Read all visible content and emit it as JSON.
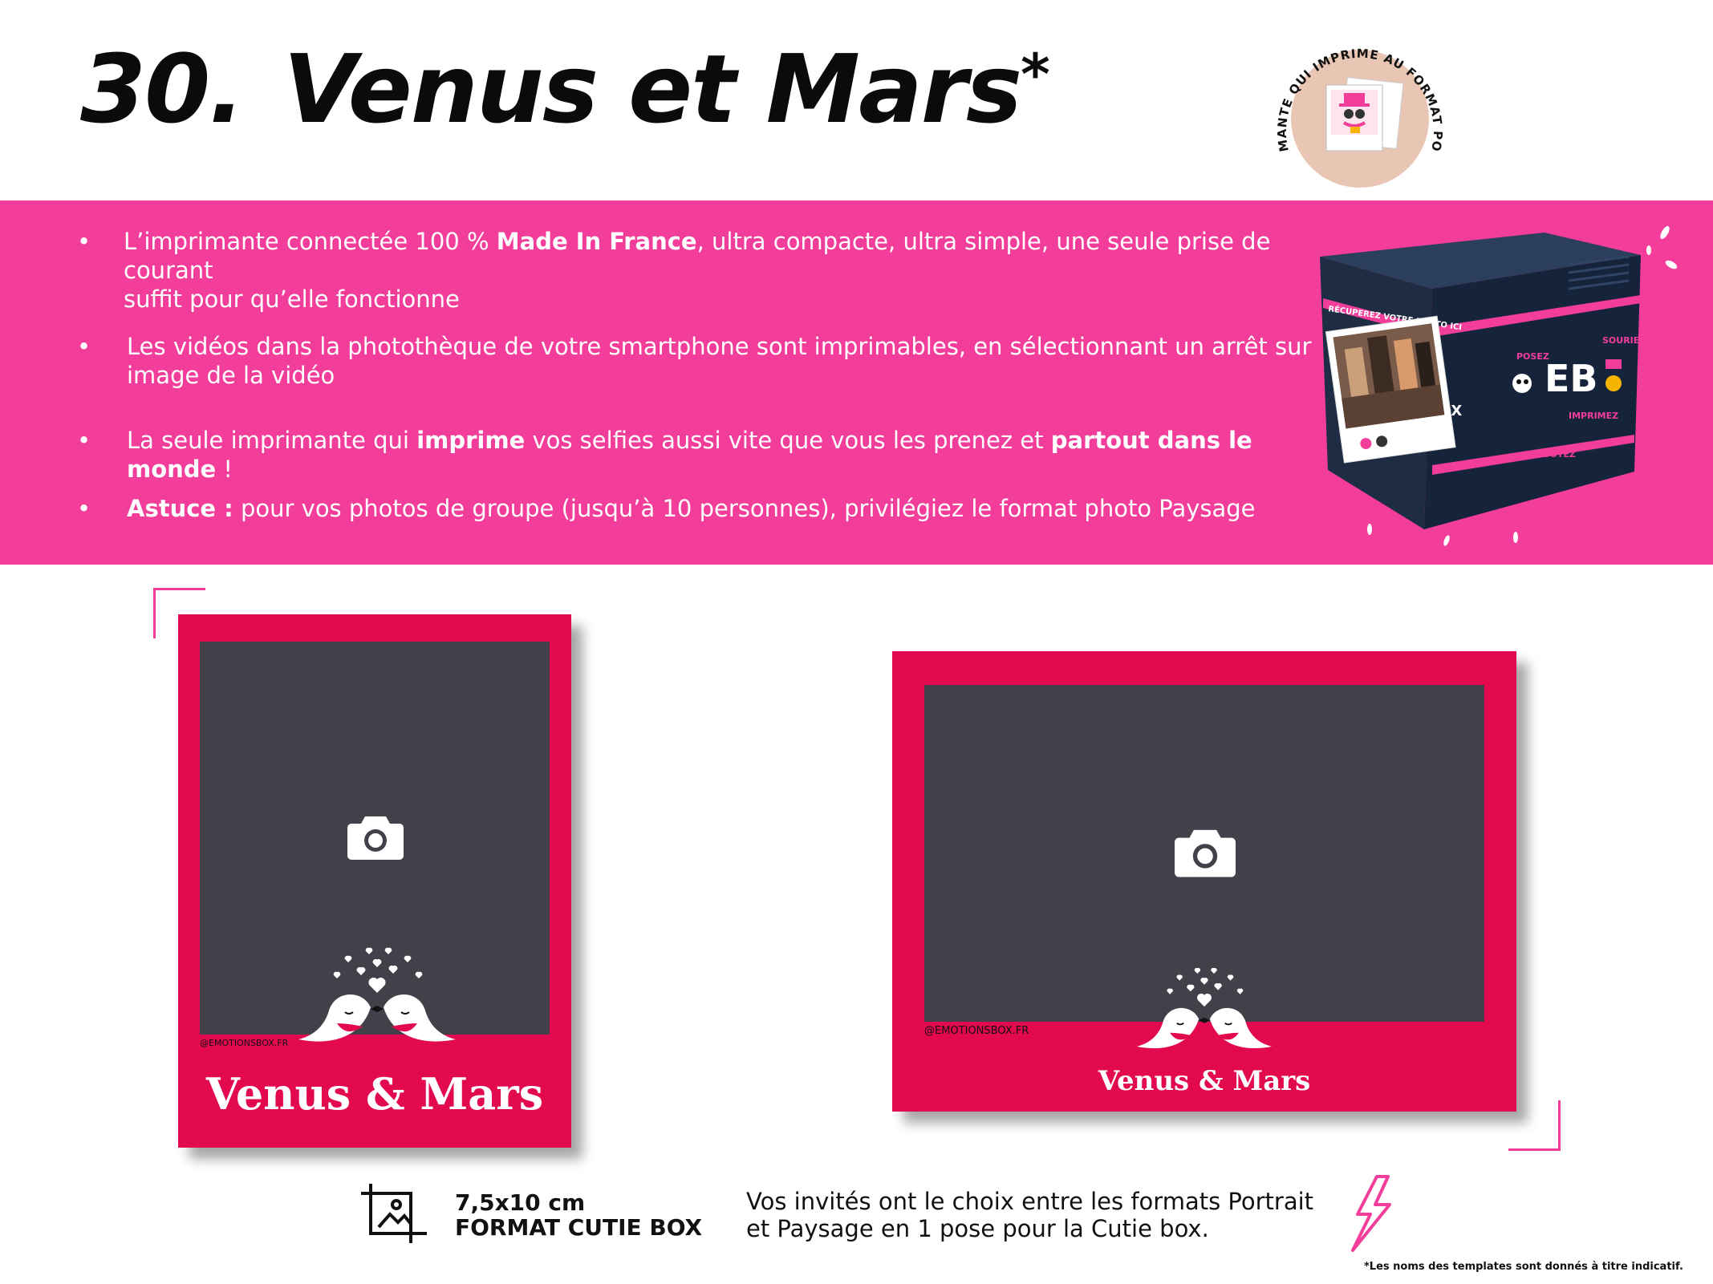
{
  "header": {
    "number": "30.",
    "title": "Venus et Mars",
    "asterisk": "*"
  },
  "badge": {
    "text": "L'IMPRIMANTE QUI IMPRIME AU FORMAT POLAROID",
    "icon": "polaroid-printer-icon"
  },
  "features": [
    {
      "pre": "L’imprimante connectée 100 % ",
      "bold": "Made In France",
      "post": ", ultra compacte, ultra simple, une seule prise de courant",
      "line2": "suffit pour qu’elle fonctionne"
    },
    {
      "pre": "Les vidéos dans la photothèque de votre smartphone sont imprimables, en sélectionnant un arrêt sur",
      "line2": "image de la vidéo"
    },
    {
      "pre": "La seule imprimante qui ",
      "bold": "imprime",
      "mid": " vos selfies aussi vite que vous les prenez et ",
      "bold2": "partout dans le monde",
      "post": " !"
    },
    {
      "bold": "Astuce :",
      "post": " pour vos photos de groupe (jusqu’à 10 personnes), privilégiez le format photo Paysage"
    }
  ],
  "product_box": {
    "brand_mark": "EB",
    "print_label": "RÉCUPEREZ VOTRE PHOTO ICI",
    "side_word": "BOX",
    "stickers": [
      "POSEZ",
      "SOURIEZ",
      "IMPRIMEZ",
      "SHOOTEZ"
    ]
  },
  "templates": {
    "portrait": {
      "name": "Venus & Mars",
      "handle": "@EMOTIONSBOX.FR",
      "icon": "camera-icon"
    },
    "landscape": {
      "name": "Venus & Mars",
      "handle": "@EMOTIONSBOX.FR",
      "icon": "camera-icon"
    }
  },
  "footer": {
    "format_size": "7,5x10 cm",
    "format_name": "FORMAT CUTIE BOX",
    "choice_line1": "Vos invités ont le choix entre les formats Portrait",
    "choice_line2": "et Paysage en 1 pose pour la Cutie box.",
    "disclaimer": "*Les noms des templates sont donnés à titre indicatif."
  },
  "colors": {
    "band_pink": "#f23d9a",
    "template_red": "#e2094f",
    "photo_hole": "#434049"
  }
}
